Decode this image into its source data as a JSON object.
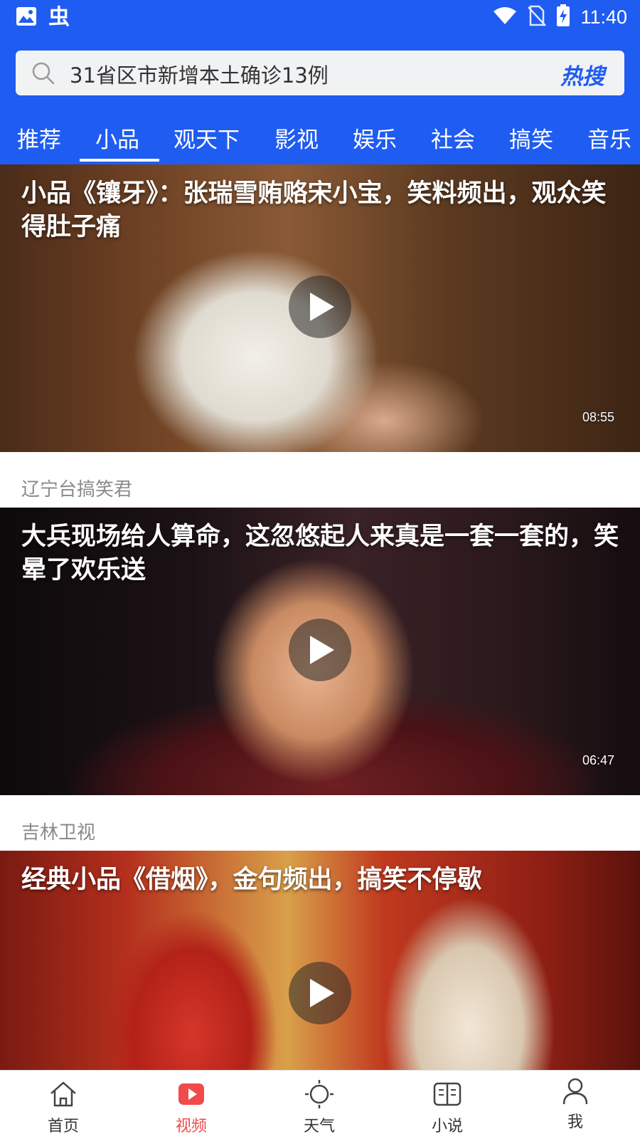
{
  "status_bar": {
    "time": "11:40",
    "left_icons": [
      "image-icon",
      "bug-app-icon"
    ],
    "right_icons": [
      "wifi-icon",
      "no-sim-icon",
      "battery-charging-icon"
    ],
    "bug_glyph": "虫"
  },
  "search": {
    "query": "31省区市新增本土确诊13例",
    "hot_label": "热搜"
  },
  "tabs": {
    "items": [
      {
        "label": "推荐"
      },
      {
        "label": "小品"
      },
      {
        "label": "观天下"
      },
      {
        "label": "影视"
      },
      {
        "label": "娱乐"
      },
      {
        "label": "社会"
      },
      {
        "label": "搞笑"
      },
      {
        "label": "音乐"
      }
    ],
    "active_label": "小品"
  },
  "feed": [
    {
      "title": "小品《镶牙》：张瑞雪贿赂宋小宝，笑料频出，观众笑得肚子痛",
      "duration": "08:55",
      "source": "辽宁台搞笑君"
    },
    {
      "title": "大兵现场给人算命，这忽悠起人来真是一套一套的，笑晕了欢乐送",
      "duration": "06:47",
      "source": "吉林卫视"
    },
    {
      "title": "经典小品《借烟》，金句频出，搞笑不停歇",
      "duration": "",
      "source": ""
    }
  ],
  "bottom_nav": {
    "items": [
      {
        "label": "首页",
        "icon": "home-icon"
      },
      {
        "label": "视频",
        "icon": "video-play-icon"
      },
      {
        "label": "天气",
        "icon": "sun-icon"
      },
      {
        "label": "小说",
        "icon": "book-icon"
      },
      {
        "label": "我",
        "icon": "person-icon"
      }
    ],
    "active_label": "视频"
  },
  "colors": {
    "header_blue": "#1f5cf2",
    "active_red": "#f04a4a",
    "source_gray": "#8a8a8a"
  }
}
